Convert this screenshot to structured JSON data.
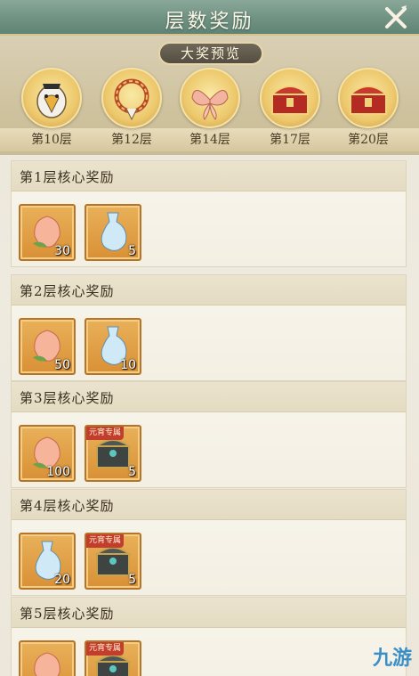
{
  "header": {
    "title": "层数奖励"
  },
  "preview": {
    "label": "大奖预览",
    "milestones": [
      {
        "level": "第10层",
        "icon": "eagle-icon"
      },
      {
        "level": "第12层",
        "icon": "bracelet-icon"
      },
      {
        "level": "第14层",
        "icon": "wings-icon"
      },
      {
        "level": "第17层",
        "icon": "red-chest-icon"
      },
      {
        "level": "第20层",
        "icon": "red-chest-icon"
      }
    ]
  },
  "rows": [
    {
      "title": "第1层核心奖励",
      "items": [
        {
          "icon": "peach-icon",
          "qty": "30"
        },
        {
          "icon": "water-vase-icon",
          "qty": "5"
        }
      ]
    },
    {
      "title": "第2层核心奖励",
      "items": [
        {
          "icon": "peach-icon",
          "qty": "50"
        },
        {
          "icon": "water-vase-icon",
          "qty": "10"
        }
      ]
    },
    {
      "title": "第3层核心奖励",
      "items": [
        {
          "icon": "peach-icon",
          "qty": "100"
        },
        {
          "icon": "dark-chest-icon",
          "qty": "5",
          "tag": "元宵专属"
        }
      ]
    },
    {
      "title": "第4层核心奖励",
      "items": [
        {
          "icon": "water-vase-icon",
          "qty": "20"
        },
        {
          "icon": "dark-chest-icon",
          "qty": "5",
          "tag": "元宵专属"
        }
      ]
    },
    {
      "title": "第5层核心奖励",
      "items": [
        {
          "icon": "peach-icon",
          "qty": ""
        },
        {
          "icon": "dark-chest-icon",
          "qty": "",
          "tag": "元宵专属"
        }
      ]
    }
  ],
  "watermark": "九游"
}
